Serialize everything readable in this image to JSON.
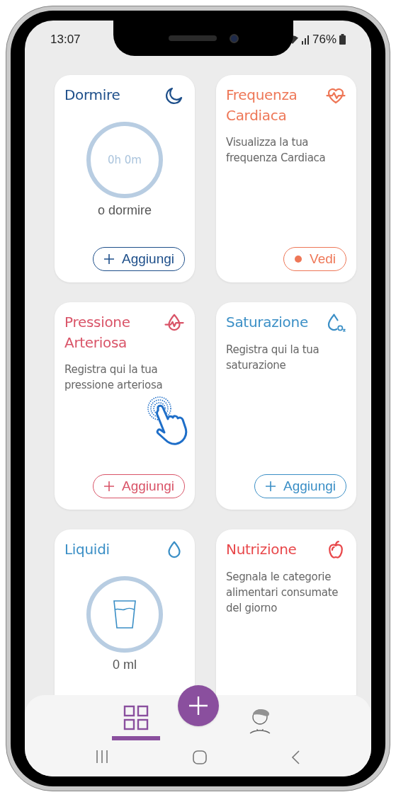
{
  "status_bar": {
    "time": "13:07",
    "battery": "76%"
  },
  "cards": [
    {
      "title": "Dormire",
      "color": "#1e4f8a",
      "kind": "ring",
      "ring_text": "0h 0m",
      "caption": "o dormire",
      "button": {
        "label": "Aggiungi",
        "kind": "add"
      }
    },
    {
      "title": "Frequenza Cardiaca",
      "color": "#ee7757",
      "kind": "text",
      "description": "Visualizza la tua frequenza Cardiaca",
      "button": {
        "label": "Vedi",
        "kind": "view"
      }
    },
    {
      "title": "Pressione Arteriosa",
      "color": "#d95468",
      "kind": "text",
      "description": "Registra qui la tua pressione arteriosa",
      "touch_hint": true,
      "button": {
        "label": "Aggiungi",
        "kind": "add"
      }
    },
    {
      "title": "Saturazione",
      "color": "#3b8fc6",
      "kind": "text",
      "description": "Registra qui la tua saturazione",
      "button": {
        "label": "Aggiungi",
        "kind": "add"
      }
    },
    {
      "title": "Liquidi",
      "color": "#3b8fc6",
      "kind": "ring",
      "caption": "0 ml"
    },
    {
      "title": "Nutrizione",
      "color": "#e8474a",
      "kind": "text",
      "description": "Segnala le categorie alimentari consumate del giorno"
    }
  ],
  "nav": {
    "items": [
      {
        "selected": true
      },
      {
        "selected": false
      }
    ]
  }
}
